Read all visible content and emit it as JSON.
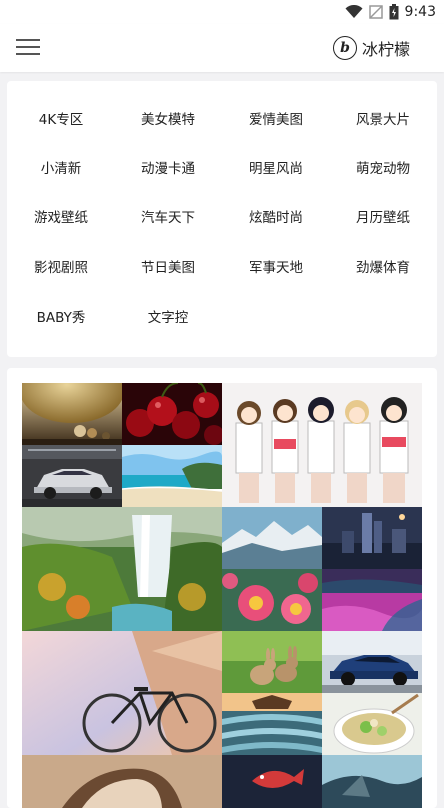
{
  "status": {
    "time": "9:43"
  },
  "header": {
    "logo_letter": "b",
    "brand": "冰柠檬"
  },
  "categories": [
    [
      "4K专区",
      "美女模特",
      "爱情美图",
      "风景大片"
    ],
    [
      "小清新",
      "动漫卡通",
      "明星风尚",
      "萌宠动物"
    ],
    [
      "游戏壁纸",
      "汽车天下",
      "炫酷时尚",
      "月历壁纸"
    ],
    [
      "影视剧照",
      "节日美图",
      "军事天地",
      "劲爆体育"
    ],
    [
      "BABY秀",
      "文字控"
    ]
  ],
  "gallery": {
    "tiles": [
      "planets",
      "cherries",
      "anime-girls",
      "sports-car",
      "beach",
      "waterfall",
      "snow-mountains",
      "scifi-city",
      "pink-flowers",
      "purple-field",
      "bicycle",
      "rabbits",
      "blue-car",
      "rice-terraces",
      "soup-bowl",
      "bottom-left",
      "bottom-fish",
      "bottom-right"
    ]
  }
}
